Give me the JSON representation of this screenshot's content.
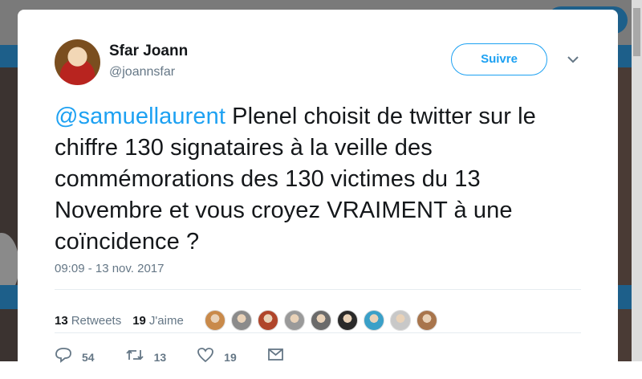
{
  "user": {
    "name": "Sfar Joann",
    "handle": "@joannsfar"
  },
  "follow_label": "Suivre",
  "tweet": {
    "mention": "@samuellaurent",
    "text": " Plenel choisit de twitter sur le chiffre 130 signataires à la veille des commémorations des 130 victimes du 13 Novembre et vous croyez VRAIMENT à une coïncidence ?",
    "timestamp": "09:09 - 13 nov. 2017"
  },
  "stats": {
    "retweets_count": "13",
    "retweets_label": "Retweets",
    "likes_count": "19",
    "likes_label": "J'aime"
  },
  "liker_colors": [
    "#c98a4a",
    "#8b8b8b",
    "#b0452a",
    "#9a9a9a",
    "#6b6b6b",
    "#2a2a2a",
    "#3aa0c8",
    "#c8c8c8",
    "#a8754c"
  ],
  "actions": {
    "replies": "54",
    "retweets": "13",
    "likes": "19"
  },
  "colors": {
    "accent": "#1da1f2",
    "muted": "#657786"
  }
}
